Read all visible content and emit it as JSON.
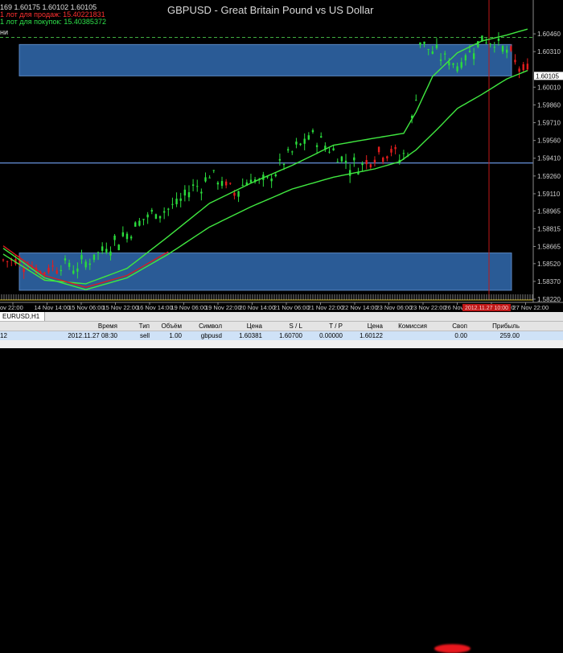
{
  "window": {
    "title": "GBPUSD - Great Britain Pound vs US Dollar"
  },
  "header": {
    "ohlc_line": "169 1.60175 1.60102 1.60105",
    "sell_line": "1 лот для продаж: 15.40221831",
    "buy_line": "1 лот для покупок: 15.40385372",
    "indicator_fragment": "ни"
  },
  "price_axis": {
    "labels": [
      "1.60460",
      "1.60310",
      "1.60105",
      "1.60010",
      "1.59860",
      "1.59710",
      "1.59560",
      "1.59410",
      "1.59260",
      "1.59110",
      "1.58965",
      "1.58815",
      "1.58665",
      "1.58520",
      "1.58370",
      "1.58220"
    ],
    "current": "1.60105"
  },
  "time_axis": {
    "labels": [
      "ov 22:00",
      "14 Nov 14:00",
      "15 Nov 06:00",
      "15 Nov 22:00",
      "16 Nov 14:00",
      "19 Nov 06:00",
      "19 Nov 22:00",
      "20 Nov 14:00",
      "21 Nov 06:00",
      "21 Nov 22:00",
      "22 Nov 14:00",
      "23 Nov 06:00",
      "23 Nov 22:00",
      "26 Nov 14:00",
      "27 Nov 06:00",
      "27 Nov 22:00"
    ],
    "highlight": "2012.11.27 10:00"
  },
  "chart_data": {
    "type": "candlestick",
    "title": "GBPUSD - Great Britain Pound vs US Dollar",
    "symbol": "GBPUSD",
    "ylim": [
      1.5822,
      1.6061
    ],
    "current_price": 1.60105,
    "zones": [
      {
        "from": 1.60105,
        "to": 1.6037,
        "color": "#2a5b96"
      },
      {
        "from": 1.58295,
        "to": 1.5861,
        "color": "#2a5b96"
      }
    ],
    "horizontal_line": 1.5937,
    "price_path": [
      [
        0,
        1.5855
      ],
      [
        6,
        1.5853
      ],
      [
        9,
        1.5845
      ],
      [
        14,
        1.5852
      ],
      [
        18,
        1.5848
      ],
      [
        22,
        1.5858
      ],
      [
        25,
        1.5866
      ],
      [
        28,
        1.5872
      ],
      [
        31,
        1.588
      ],
      [
        34,
        1.589
      ],
      [
        37,
        1.5895
      ],
      [
        40,
        1.5898
      ],
      [
        43,
        1.5905
      ],
      [
        46,
        1.5917
      ],
      [
        48,
        1.5918
      ],
      [
        50,
        1.5928
      ],
      [
        53,
        1.592
      ],
      [
        56,
        1.5912
      ],
      [
        60,
        1.5925
      ],
      [
        63,
        1.5918
      ],
      [
        66,
        1.593
      ],
      [
        69,
        1.5942
      ],
      [
        72,
        1.5952
      ],
      [
        75,
        1.596
      ],
      [
        78,
        1.5952
      ],
      [
        81,
        1.5944
      ],
      [
        84,
        1.5935
      ],
      [
        87,
        1.5935
      ],
      [
        90,
        1.5945
      ],
      [
        94,
        1.5948
      ],
      [
        96,
        1.594
      ],
      [
        98,
        1.5948
      ],
      [
        100,
        1.5995
      ],
      [
        101,
        1.604
      ],
      [
        104,
        1.603
      ],
      [
        107,
        1.6025
      ],
      [
        110,
        1.602
      ],
      [
        113,
        1.603
      ],
      [
        116,
        1.6042
      ],
      [
        119,
        1.604
      ],
      [
        122,
        1.603
      ],
      [
        125,
        1.6018
      ],
      [
        127,
        1.6012
      ]
    ],
    "red_segments": [
      [
        0,
        13
      ],
      [
        54,
        56
      ],
      [
        88,
        95
      ],
      [
        123,
        127
      ]
    ],
    "ma_fast": [
      [
        0,
        1.586
      ],
      [
        10,
        1.5838
      ],
      [
        20,
        1.5835
      ],
      [
        30,
        1.5848
      ],
      [
        40,
        1.5875
      ],
      [
        50,
        1.5903
      ],
      [
        60,
        1.592
      ],
      [
        70,
        1.5935
      ],
      [
        80,
        1.5952
      ],
      [
        90,
        1.5958
      ],
      [
        97,
        1.5962
      ],
      [
        100,
        1.598
      ],
      [
        104,
        1.601
      ],
      [
        110,
        1.603
      ],
      [
        116,
        1.604
      ],
      [
        122,
        1.6045
      ],
      [
        127,
        1.605
      ]
    ],
    "ma_slow": [
      [
        0,
        1.5865
      ],
      [
        10,
        1.584
      ],
      [
        20,
        1.583
      ],
      [
        30,
        1.584
      ],
      [
        40,
        1.586
      ],
      [
        50,
        1.5883
      ],
      [
        60,
        1.59
      ],
      [
        70,
        1.5915
      ],
      [
        80,
        1.5925
      ],
      [
        90,
        1.5932
      ],
      [
        96,
        1.5938
      ],
      [
        100,
        1.5948
      ],
      [
        105,
        1.5965
      ],
      [
        110,
        1.5983
      ],
      [
        116,
        1.5995
      ],
      [
        122,
        1.6008
      ],
      [
        127,
        1.6015
      ]
    ]
  },
  "terminal": {
    "tab": "EURUSD,H1",
    "columns": [
      "",
      "Время",
      "Тип",
      "Объём",
      "Символ",
      "Цена",
      "S / L",
      "T / P",
      "Цена",
      "Комиссия",
      "Своп",
      "Прибыль"
    ],
    "rows": [
      [
        "12",
        "2012.11.27 08:30",
        "sell",
        "1.00",
        "gbpusd",
        "1.60381",
        "1.60700",
        "0.00000",
        "1.60122",
        "",
        "0.00",
        "259.00"
      ]
    ]
  },
  "colors": {
    "bull": "#2adb3c",
    "bear": "#e31d1d",
    "zone": "#2a5b96",
    "ma": "#40e840",
    "axis_text": "#d0d0d0"
  }
}
